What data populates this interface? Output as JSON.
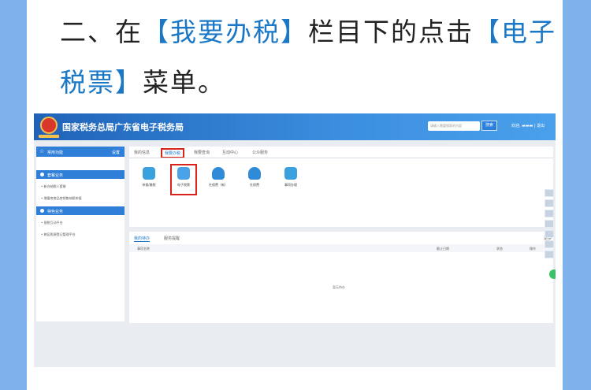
{
  "heading": {
    "line1_pre": "二、在",
    "line1_hl1": "【我要办税】",
    "line1_mid": "栏目下的点击",
    "line1_hl2": "【电子",
    "line2_hl": "税票】",
    "line2_post": "菜单。"
  },
  "portal": {
    "site_title": "国家税务总局广东省电子税务局",
    "search_placeholder": "请输入需要搜索的内容",
    "search_button": "搜索",
    "welcome": "欢迎,  ▬▬▬  | 退出"
  },
  "sidebar": {
    "title": "常用功能",
    "settings": "设置",
    "sections": [
      {
        "label": "套餐业务",
        "items": [
          "新办纳税人套餐",
          "增量房商品房销售纳税申报"
        ]
      },
      {
        "label": "特色业务",
        "items": [
          "银税互动平台",
          "跨区税源登记管理平台"
        ]
      }
    ]
  },
  "tabs": [
    "我的信息",
    "我要办税",
    "我要查询",
    "互动中心",
    "公众服务"
  ],
  "tiles": [
    {
      "label": "申报/缴税",
      "color": "#3aa0de"
    },
    {
      "label": "电子税票",
      "color": "#4aa3e8"
    },
    {
      "label": "社保费（新）",
      "color": "#2f8ad8"
    },
    {
      "label": "社保费",
      "color": "#2f8ad8"
    },
    {
      "label": "事项办理",
      "color": "#3aa0de"
    }
  ],
  "bottom": {
    "tabs": [
      "我的待办",
      "服务提醒"
    ],
    "more": "更多",
    "columns": [
      "事项名称",
      "截止日期",
      "状态",
      "操作"
    ],
    "empty_text": "暂无待办"
  },
  "colors": {
    "accent": "#1b78c6",
    "highlight_border": "#d9221c",
    "page_bg": "#7fb2ea"
  }
}
